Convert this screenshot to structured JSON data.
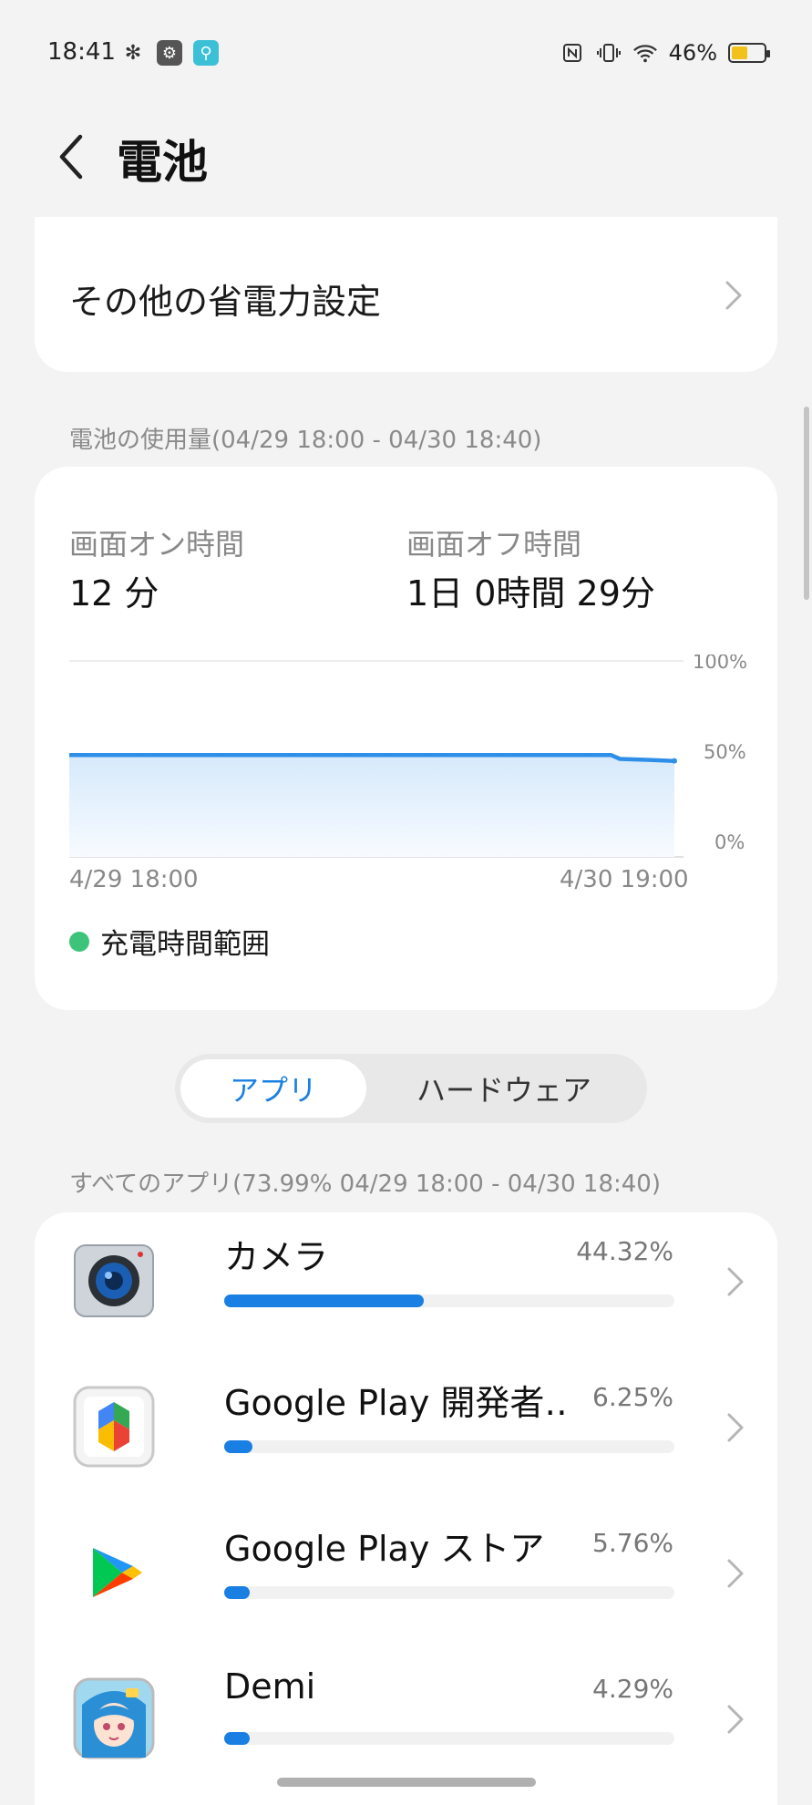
{
  "status_bar": {
    "time": "18:41",
    "left_icons": [
      "fan-icon",
      "gear-icon",
      "usb-icon"
    ],
    "right_icons": [
      "nfc-icon",
      "vibrate-icon",
      "wifi-icon"
    ],
    "battery_percent": "46%",
    "battery_level": 0.46,
    "battery_charging": true
  },
  "header": {
    "back_icon": "chevron-left-icon",
    "title": "電池"
  },
  "power_settings": {
    "label": "その他の省電力設定"
  },
  "usage": {
    "caption": "電池の使用量(04/29 18:00 - 04/30 18:40)",
    "screen_on_label": "画面オン時間",
    "screen_on_value": "12 分",
    "screen_off_label": "画面オフ時間",
    "screen_off_value": "1日 0時間 29分",
    "legend_label": "充電時間範囲",
    "colors": {
      "line": "#2f8fe8",
      "fill_top": "#d6e9fb",
      "legend": "#3ec47a"
    }
  },
  "chart_data": {
    "type": "area",
    "x_start_label": "4/29 18:00",
    "x_end_label": "4/30 19:00",
    "y_ticks": [
      "100%",
      "50%",
      "0%"
    ],
    "ylim": [
      0,
      100
    ],
    "points": [
      {
        "t": 0.0,
        "v": 52
      },
      {
        "t": 0.5,
        "v": 52
      },
      {
        "t": 0.895,
        "v": 52
      },
      {
        "t": 0.91,
        "v": 50
      },
      {
        "t": 0.96,
        "v": 49.5
      },
      {
        "t": 1.0,
        "v": 49
      }
    ]
  },
  "segmented": {
    "apps_label": "アプリ",
    "hardware_label": "ハードウェア",
    "selected": "apps"
  },
  "apps_caption": "すべてのアプリ(73.99% 04/29 18:00 - 04/30 18:40)",
  "apps": [
    {
      "name": "カメラ",
      "percent": "44.32%",
      "fraction": 0.4432,
      "icon": "camera-app-icon"
    },
    {
      "name": "Google Play 開発者‥",
      "percent": "6.25%",
      "fraction": 0.0625,
      "icon": "google-play-services-icon"
    },
    {
      "name": "Google Play ストア",
      "percent": "5.76%",
      "fraction": 0.0576,
      "icon": "google-play-store-icon"
    },
    {
      "name": "Demi",
      "percent": "4.29%",
      "fraction": 0.0429,
      "icon": "demi-app-icon"
    }
  ],
  "bar_scale_max": 1.0
}
